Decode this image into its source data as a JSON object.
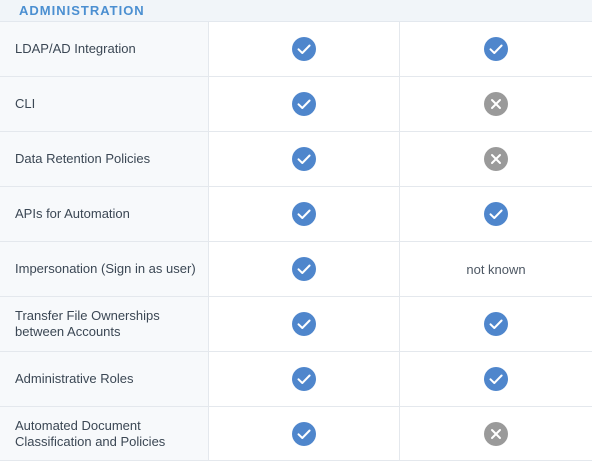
{
  "section": {
    "title": "ADMINISTRATION"
  },
  "colors": {
    "check": "#4f86cc",
    "cross": "#9a9a9a",
    "header_text": "#4b8fd1"
  },
  "rows": [
    {
      "feature": "LDAP/AD Integration",
      "col1": "check-icon",
      "col2": "check-icon"
    },
    {
      "feature": "CLI",
      "col1": "check-icon",
      "col2": "cross-icon"
    },
    {
      "feature": "Data Retention Policies",
      "col1": "check-icon",
      "col2": "cross-icon"
    },
    {
      "feature": "APIs for Automation",
      "col1": "check-icon",
      "col2": "check-icon"
    },
    {
      "feature": "Impersonation (Sign in as user)",
      "col1": "check-icon",
      "col2_text": "not known"
    },
    {
      "feature": "Transfer File Ownerships between Accounts",
      "col1": "check-icon",
      "col2": "check-icon"
    },
    {
      "feature": "Administrative Roles",
      "col1": "check-icon",
      "col2": "check-icon"
    },
    {
      "feature": "Automated Document Classification and Policies",
      "col1": "check-icon",
      "col2": "cross-icon"
    }
  ]
}
